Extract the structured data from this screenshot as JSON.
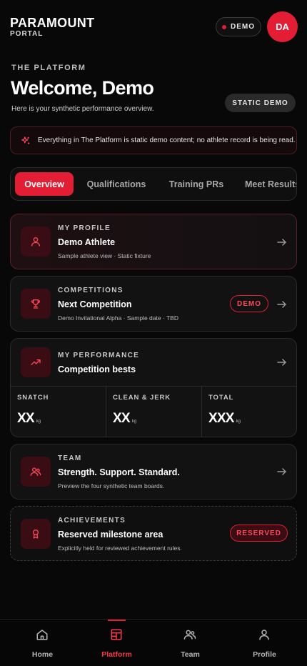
{
  "brand": {
    "title": "PARAMOUNT",
    "subtitle": "PORTAL"
  },
  "header": {
    "demo_label": "DEMO",
    "avatar_initials": "DA"
  },
  "intro": {
    "eyebrow": "THE PLATFORM",
    "title": "Welcome, Demo",
    "subtitle": "Here is your synthetic performance overview.",
    "badge": "STATIC DEMO"
  },
  "notice": {
    "icon": "sparkles-icon",
    "text": "Everything in The Platform is static demo content; no athlete record is being read."
  },
  "tabs": [
    {
      "label": "Overview",
      "active": true
    },
    {
      "label": "Qualifications",
      "active": false
    },
    {
      "label": "Training PRs",
      "active": false
    },
    {
      "label": "Meet Results",
      "active": false
    }
  ],
  "cards": {
    "profile": {
      "eyebrow": "MY PROFILE",
      "title": "Demo Athlete",
      "subtitle": "Sample athlete view · Static fixture",
      "icon": "user-icon"
    },
    "competitions": {
      "eyebrow": "COMPETITIONS",
      "title": "Next Competition",
      "subtitle": "Demo Invitational Alpha · Sample date · TBD",
      "badge": "DEMO",
      "icon": "trophy-icon"
    },
    "performance": {
      "eyebrow": "MY PERFORMANCE",
      "title": "Competition bests",
      "icon": "trending-up-icon",
      "stats": [
        {
          "label": "SNATCH",
          "value": "XX",
          "unit": "kg"
        },
        {
          "label": "CLEAN & JERK",
          "value": "XX",
          "unit": "kg"
        },
        {
          "label": "TOTAL",
          "value": "XXX",
          "unit": "kg"
        }
      ]
    },
    "team": {
      "eyebrow": "TEAM",
      "title": "Strength. Support. Standard.",
      "subtitle": "Preview the four synthetic team boards.",
      "icon": "users-icon"
    },
    "achievements": {
      "eyebrow": "ACHIEVEMENTS",
      "title": "Reserved milestone area",
      "subtitle": "Explicitly held for reviewed achievement rules.",
      "badge": "RESERVED",
      "icon": "award-icon"
    }
  },
  "nav": [
    {
      "label": "Home",
      "icon": "home-icon",
      "active": false
    },
    {
      "label": "Platform",
      "icon": "layout-icon",
      "active": true
    },
    {
      "label": "Team",
      "icon": "users-icon",
      "active": false
    },
    {
      "label": "Profile",
      "icon": "user-icon",
      "active": false
    }
  ],
  "colors": {
    "accent": "#e21d34",
    "background": "#080808",
    "card": "#121213"
  }
}
